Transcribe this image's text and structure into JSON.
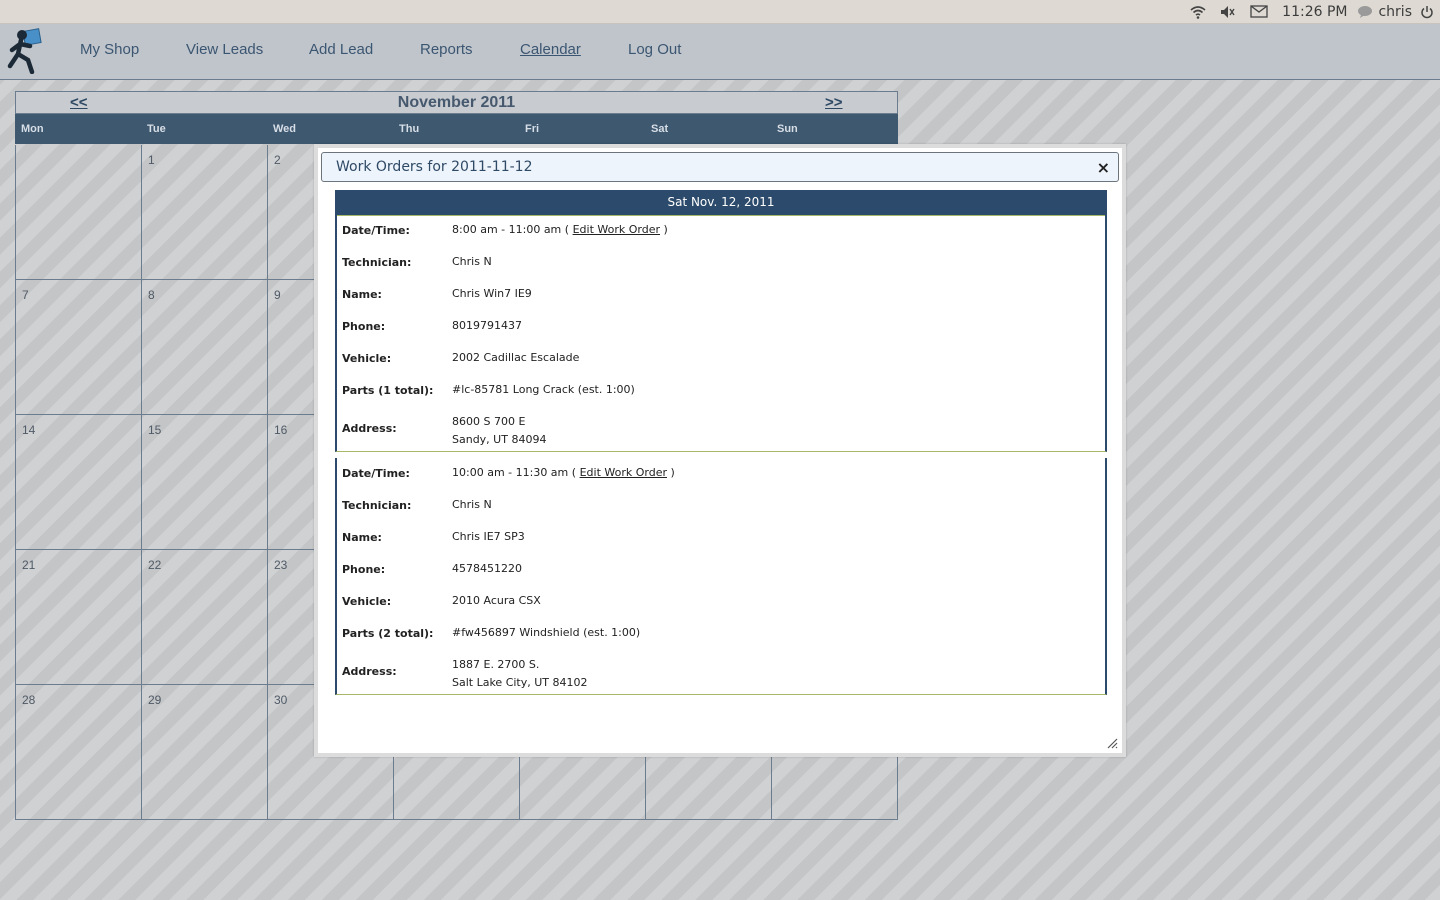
{
  "system": {
    "time": "11:26 PM",
    "user": "chris"
  },
  "nav": {
    "items": [
      "My Shop",
      "View Leads",
      "Add Lead",
      "Reports",
      "Calendar",
      "Log Out"
    ],
    "active": "Calendar"
  },
  "calendar": {
    "month_title": "November 2011",
    "prev": "<<",
    "next": ">>",
    "weekdays": [
      "Mon",
      "Tue",
      "Wed",
      "Thu",
      "Fri",
      "Sat",
      "Sun"
    ],
    "weeks": [
      [
        "",
        "1",
        "2",
        "",
        "",
        "",
        ""
      ],
      [
        "7",
        "8",
        "9",
        "",
        "",
        "",
        ""
      ],
      [
        "14",
        "15",
        "16",
        "",
        "",
        "",
        ""
      ],
      [
        "21",
        "22",
        "23",
        "",
        "",
        "",
        ""
      ],
      [
        "28",
        "29",
        "30",
        "",
        "",
        "",
        ""
      ]
    ]
  },
  "modal": {
    "title": "Work Orders for 2011-11-12",
    "close": "×",
    "day_heading": "Sat Nov. 12, 2011",
    "labels": {
      "datetime": "Date/Time:",
      "technician": "Technician:",
      "name": "Name:",
      "phone": "Phone:",
      "vehicle": "Vehicle:",
      "address": "Address:"
    },
    "edit_link": "Edit Work Order",
    "work_orders": [
      {
        "time": "8:00 am - 11:00 am",
        "technician": "Chris N",
        "name": "Chris Win7 IE9",
        "phone": "8019791437",
        "vehicle": "2002 Cadillac Escalade",
        "parts_label": "Parts (1 total):",
        "parts": "#lc-85781 Long Crack (est. 1:00)",
        "address_line1": "8600 S 700 E",
        "address_line2": "Sandy, UT 84094"
      },
      {
        "time": "10:00 am - 11:30 am",
        "technician": "Chris N",
        "name": "Chris IE7 SP3",
        "phone": "4578451220",
        "vehicle": "2010 Acura CSX",
        "parts_label": "Parts (2 total):",
        "parts": "#fw456897 Windshield (est. 1:00)",
        "address_line1": "1887 E. 2700 S.",
        "address_line2": "Salt Lake City, UT 84102"
      }
    ]
  }
}
